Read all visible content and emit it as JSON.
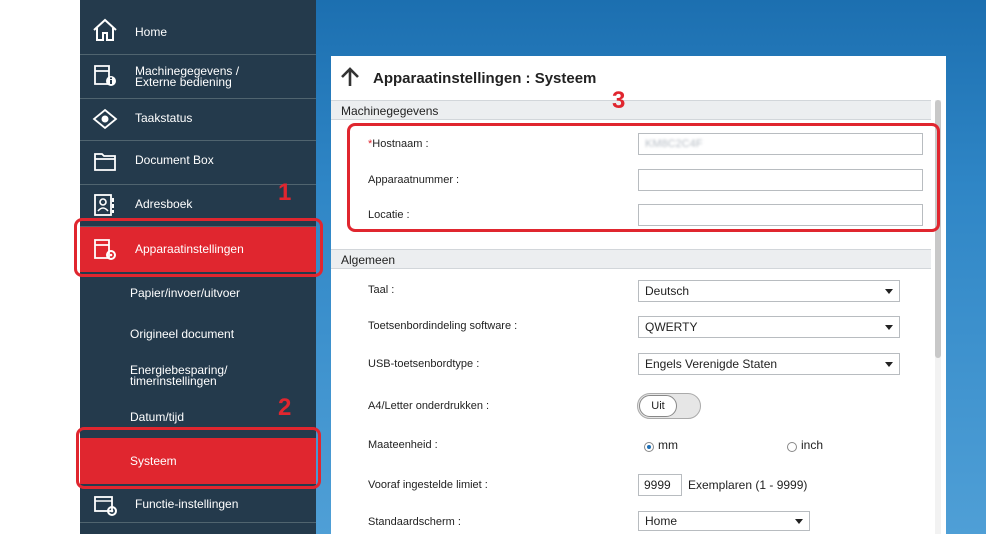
{
  "sidebar": {
    "items": [
      {
        "label": "Home",
        "icon": "home-icon"
      },
      {
        "label": "Machinegegevens /",
        "label2": "Externe bediening",
        "icon": "device-info-icon"
      },
      {
        "label": "Taakstatus",
        "icon": "eye-icon"
      },
      {
        "label": "Document Box",
        "icon": "folder-icon"
      },
      {
        "label": "Adresboek",
        "icon": "address-book-icon"
      },
      {
        "label": "Apparaatinstellingen",
        "icon": "device-settings-icon",
        "active": true
      }
    ],
    "subitems": [
      {
        "label": "Papier/invoer/uitvoer"
      },
      {
        "label": "Origineel document"
      },
      {
        "label": "Energiebesparing/",
        "label2": "timerinstellingen"
      },
      {
        "label": "Datum/tijd"
      },
      {
        "label": "Systeem",
        "active": true
      }
    ],
    "bottom_item": {
      "label": "Functie-instellingen",
      "icon": "function-settings-icon"
    }
  },
  "page": {
    "title": "Apparaatinstellingen : Systeem"
  },
  "machine_section": {
    "heading": "Machinegegevens",
    "fields": [
      {
        "label": "Hostnaam",
        "required_mark": "*",
        "suffix": " :",
        "value": "KM8C2C4F"
      },
      {
        "label": "Apparaatnummer :",
        "value": ""
      },
      {
        "label": "Locatie :",
        "value": ""
      }
    ]
  },
  "general_section": {
    "heading": "Algemeen",
    "taal": {
      "label": "Taal :",
      "value": "Deutsch"
    },
    "keyboard_layout": {
      "label": "Toetsenbordindeling software :",
      "value": "QWERTY"
    },
    "usb_keyboard": {
      "label": "USB-toetsenbordtype :",
      "value": "Engels Verenigde Staten"
    },
    "a4_letter": {
      "label": "A4/Letter onderdrukken :",
      "value": "Uit",
      "on": false
    },
    "unit": {
      "label": "Maateenheid :",
      "options": [
        "mm",
        "inch"
      ],
      "selected": "mm"
    },
    "preset_limit": {
      "label": "Vooraf ingestelde limiet :",
      "value": "9999",
      "suffix": "Exemplaren (1 - 9999)"
    },
    "default_screen": {
      "label": "Standaardscherm :",
      "value": "Home"
    }
  },
  "callouts": [
    "1",
    "2",
    "3"
  ],
  "colors": {
    "sidebar": "#243a4c",
    "active": "#e0262f",
    "accent_blue": "#2f86c6"
  }
}
